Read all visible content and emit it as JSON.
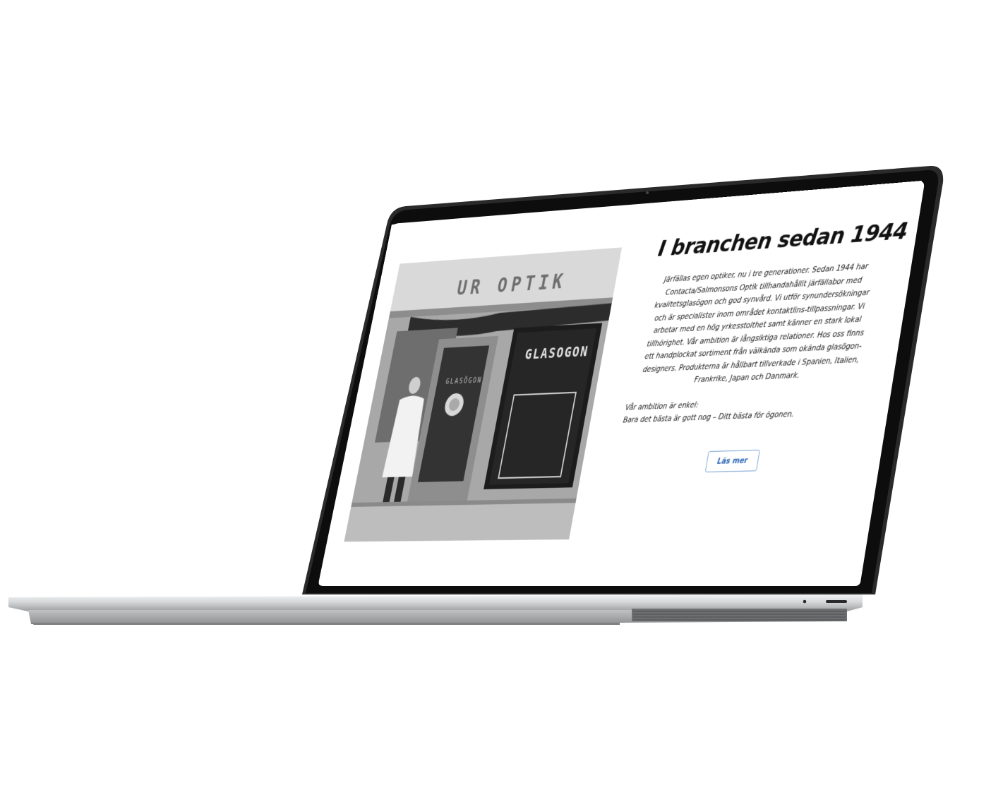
{
  "section": {
    "heading": "I branchen sedan 1944",
    "body": "Järfällas egen optiker, nu i tre generationer. Sedan 1944 har Contacta/Salmonsons Optik tillhandahållit järfällabor med kvalitetsglasögon och god synvård. Vi utför synundersökningar och är specialister inom området kontaktlins-tillpassningar. Vi arbetar med en hög yrkesstolthet samt känner en stark lokal tillhörighet. Vår ambition är långsiktiga relationer. Hos oss finns ett handplockat sortiment från välkända som okända glasögon-designers. Produkterna är hållbart tillverkade i Spanien, Italien, Frankrike, Japan och Danmark.",
    "ambition_label": "Vår ambition är enkel:",
    "ambition_text": "Bara det bästa är gott nog – Ditt bästa för ögonen.",
    "button_label": "Läs mer"
  },
  "photo": {
    "store_sign": "UR OPTIK",
    "window_sign": "GLASOGON",
    "door_sign": "GLASÖGON"
  },
  "colors": {
    "button_text": "#2d68b4",
    "button_border": "#7fa7d6",
    "bezel": "#0d0d0d",
    "base": "#c9cbcd"
  }
}
